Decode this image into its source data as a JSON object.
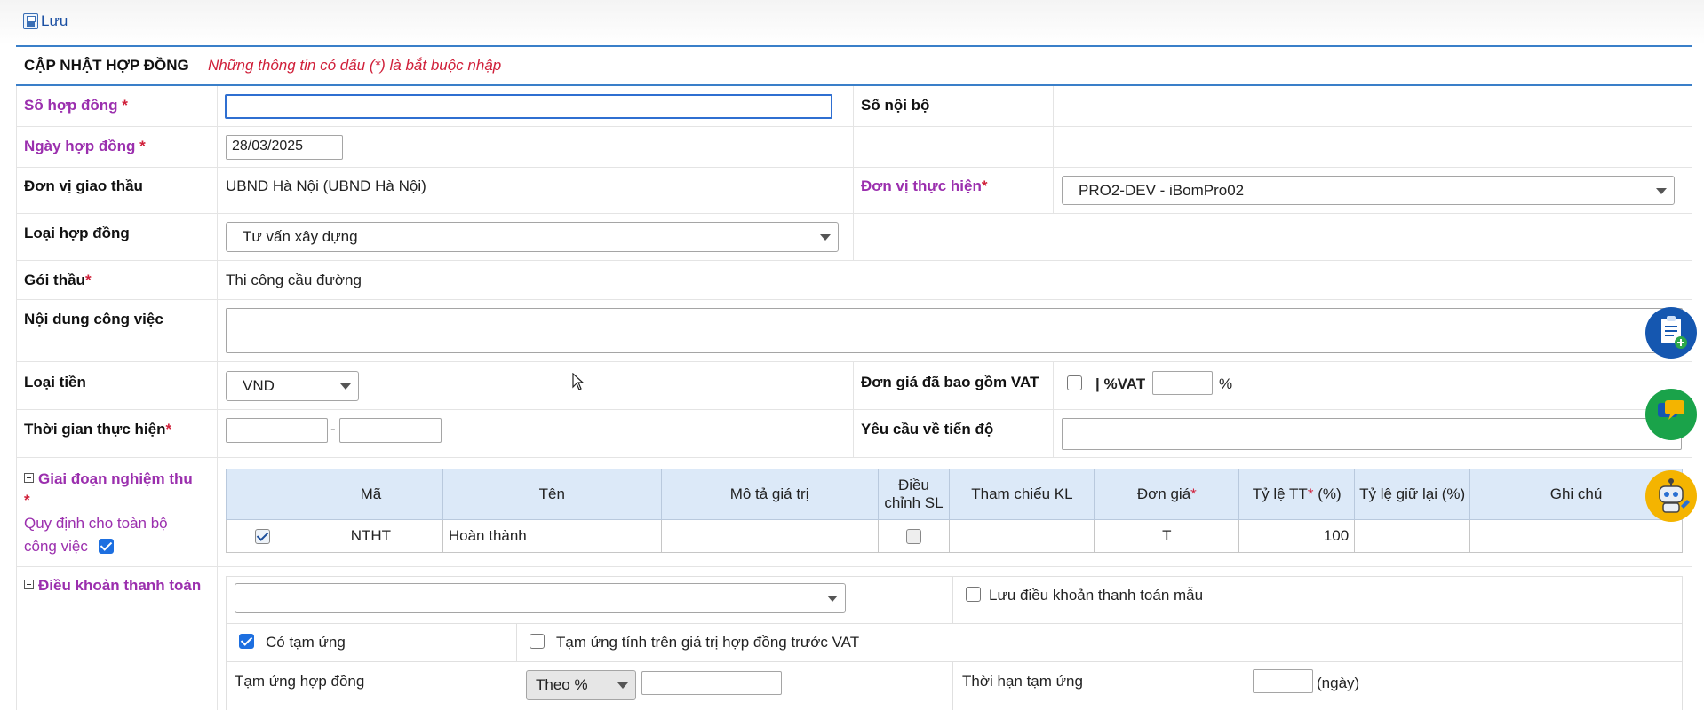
{
  "toolbar": {
    "save_label": "Lưu"
  },
  "header": {
    "title": "CẬP NHẬT HỢP ĐỒNG",
    "note": "Những thông tin có dấu (*) là bắt buộc nhập"
  },
  "form": {
    "so_hop_dong_label": "Số hợp đồng",
    "so_hop_dong_value": "",
    "so_noi_bo_label": "Số nội bộ",
    "ngay_hop_dong_label": "Ngày hợp đồng",
    "ngay_hop_dong_value": "28/03/2025",
    "don_vi_giao_thau_label": "Đơn vị giao thầu",
    "don_vi_giao_thau_value": "UBND Hà Nội (UBND Hà Nội)",
    "don_vi_thuc_hien_label": "Đơn vị thực hiện",
    "don_vi_thuc_hien_value": "PRO2-DEV - iBomPro02",
    "loai_hop_dong_label": "Loại hợp đồng",
    "loai_hop_dong_value": "Tư vấn xây dựng",
    "goi_thau_label": "Gói thầu",
    "goi_thau_value": "Thi công cầu đường",
    "noi_dung_label": "Nội dung công việc",
    "noi_dung_value": "",
    "loai_tien_label": "Loại tiền",
    "loai_tien_value": "VND",
    "don_gia_vat_label": "Đơn giá đã bao gồm VAT",
    "vat_label": "%VAT",
    "vat_value": "",
    "percent_sign": "%",
    "thoi_gian_label": "Thời gian thực hiện",
    "thoi_gian_from": "",
    "thoi_gian_sep": "-",
    "thoi_gian_to": "",
    "yeu_cau_tien_do_label": "Yêu cầu về tiến độ",
    "yeu_cau_tien_do_value": ""
  },
  "required_mark": "*",
  "giai_doan": {
    "label": "Giai đoạn nghiệm thu",
    "rule_label": "Quy định cho toàn bộ công việc",
    "rule_checked": true,
    "columns": {
      "ma": "Mã",
      "ten": "Tên",
      "mo_ta": "Mô tả giá trị",
      "dieu_chinh": "Điều chỉnh SL",
      "tham_chieu": "Tham chiếu KL",
      "don_gia": "Đơn giá",
      "ty_le_tt": "Tỷ lệ TT",
      "ty_le_tt_unit": "(%)",
      "ty_le_giu_lai": "Tỷ lệ giữ lại (%)",
      "ghi_chu": "Ghi chú"
    },
    "rows": [
      {
        "checked": true,
        "ma": "NTHT",
        "ten": "Hoàn thành",
        "mo_ta": "",
        "dieu_chinh": false,
        "tham_chieu": "",
        "don_gia": "T",
        "ty_le_tt": "100",
        "ty_le_giu_lai": "",
        "ghi_chu": ""
      }
    ]
  },
  "dieu_khoan": {
    "label": "Điều khoản thanh toán",
    "template_value": "",
    "save_template_label": "Lưu điều khoản thanh toán mẫu",
    "co_tam_ung_label": "Có tạm ứng",
    "co_tam_ung_checked": true,
    "tam_ung_truoc_vat_label": "Tạm ứng tính trên giá trị hợp đồng trước VAT",
    "tam_ung_hop_dong_label": "Tạm ứng hợp đồng",
    "tam_ung_mode": "Theo %",
    "tam_ung_value": "",
    "thoi_han_label": "Thời hạn tạm ứng",
    "thoi_han_value": "",
    "thoi_han_unit": "(ngày)"
  },
  "side_buttons": [
    "clipboard-add-icon",
    "chat-icon",
    "robot-support-icon"
  ],
  "colors": {
    "accent": "#3a7fc9",
    "required_label": "#9b2fae",
    "required_star": "#d0203a",
    "grid_header": "#dce9f8"
  }
}
